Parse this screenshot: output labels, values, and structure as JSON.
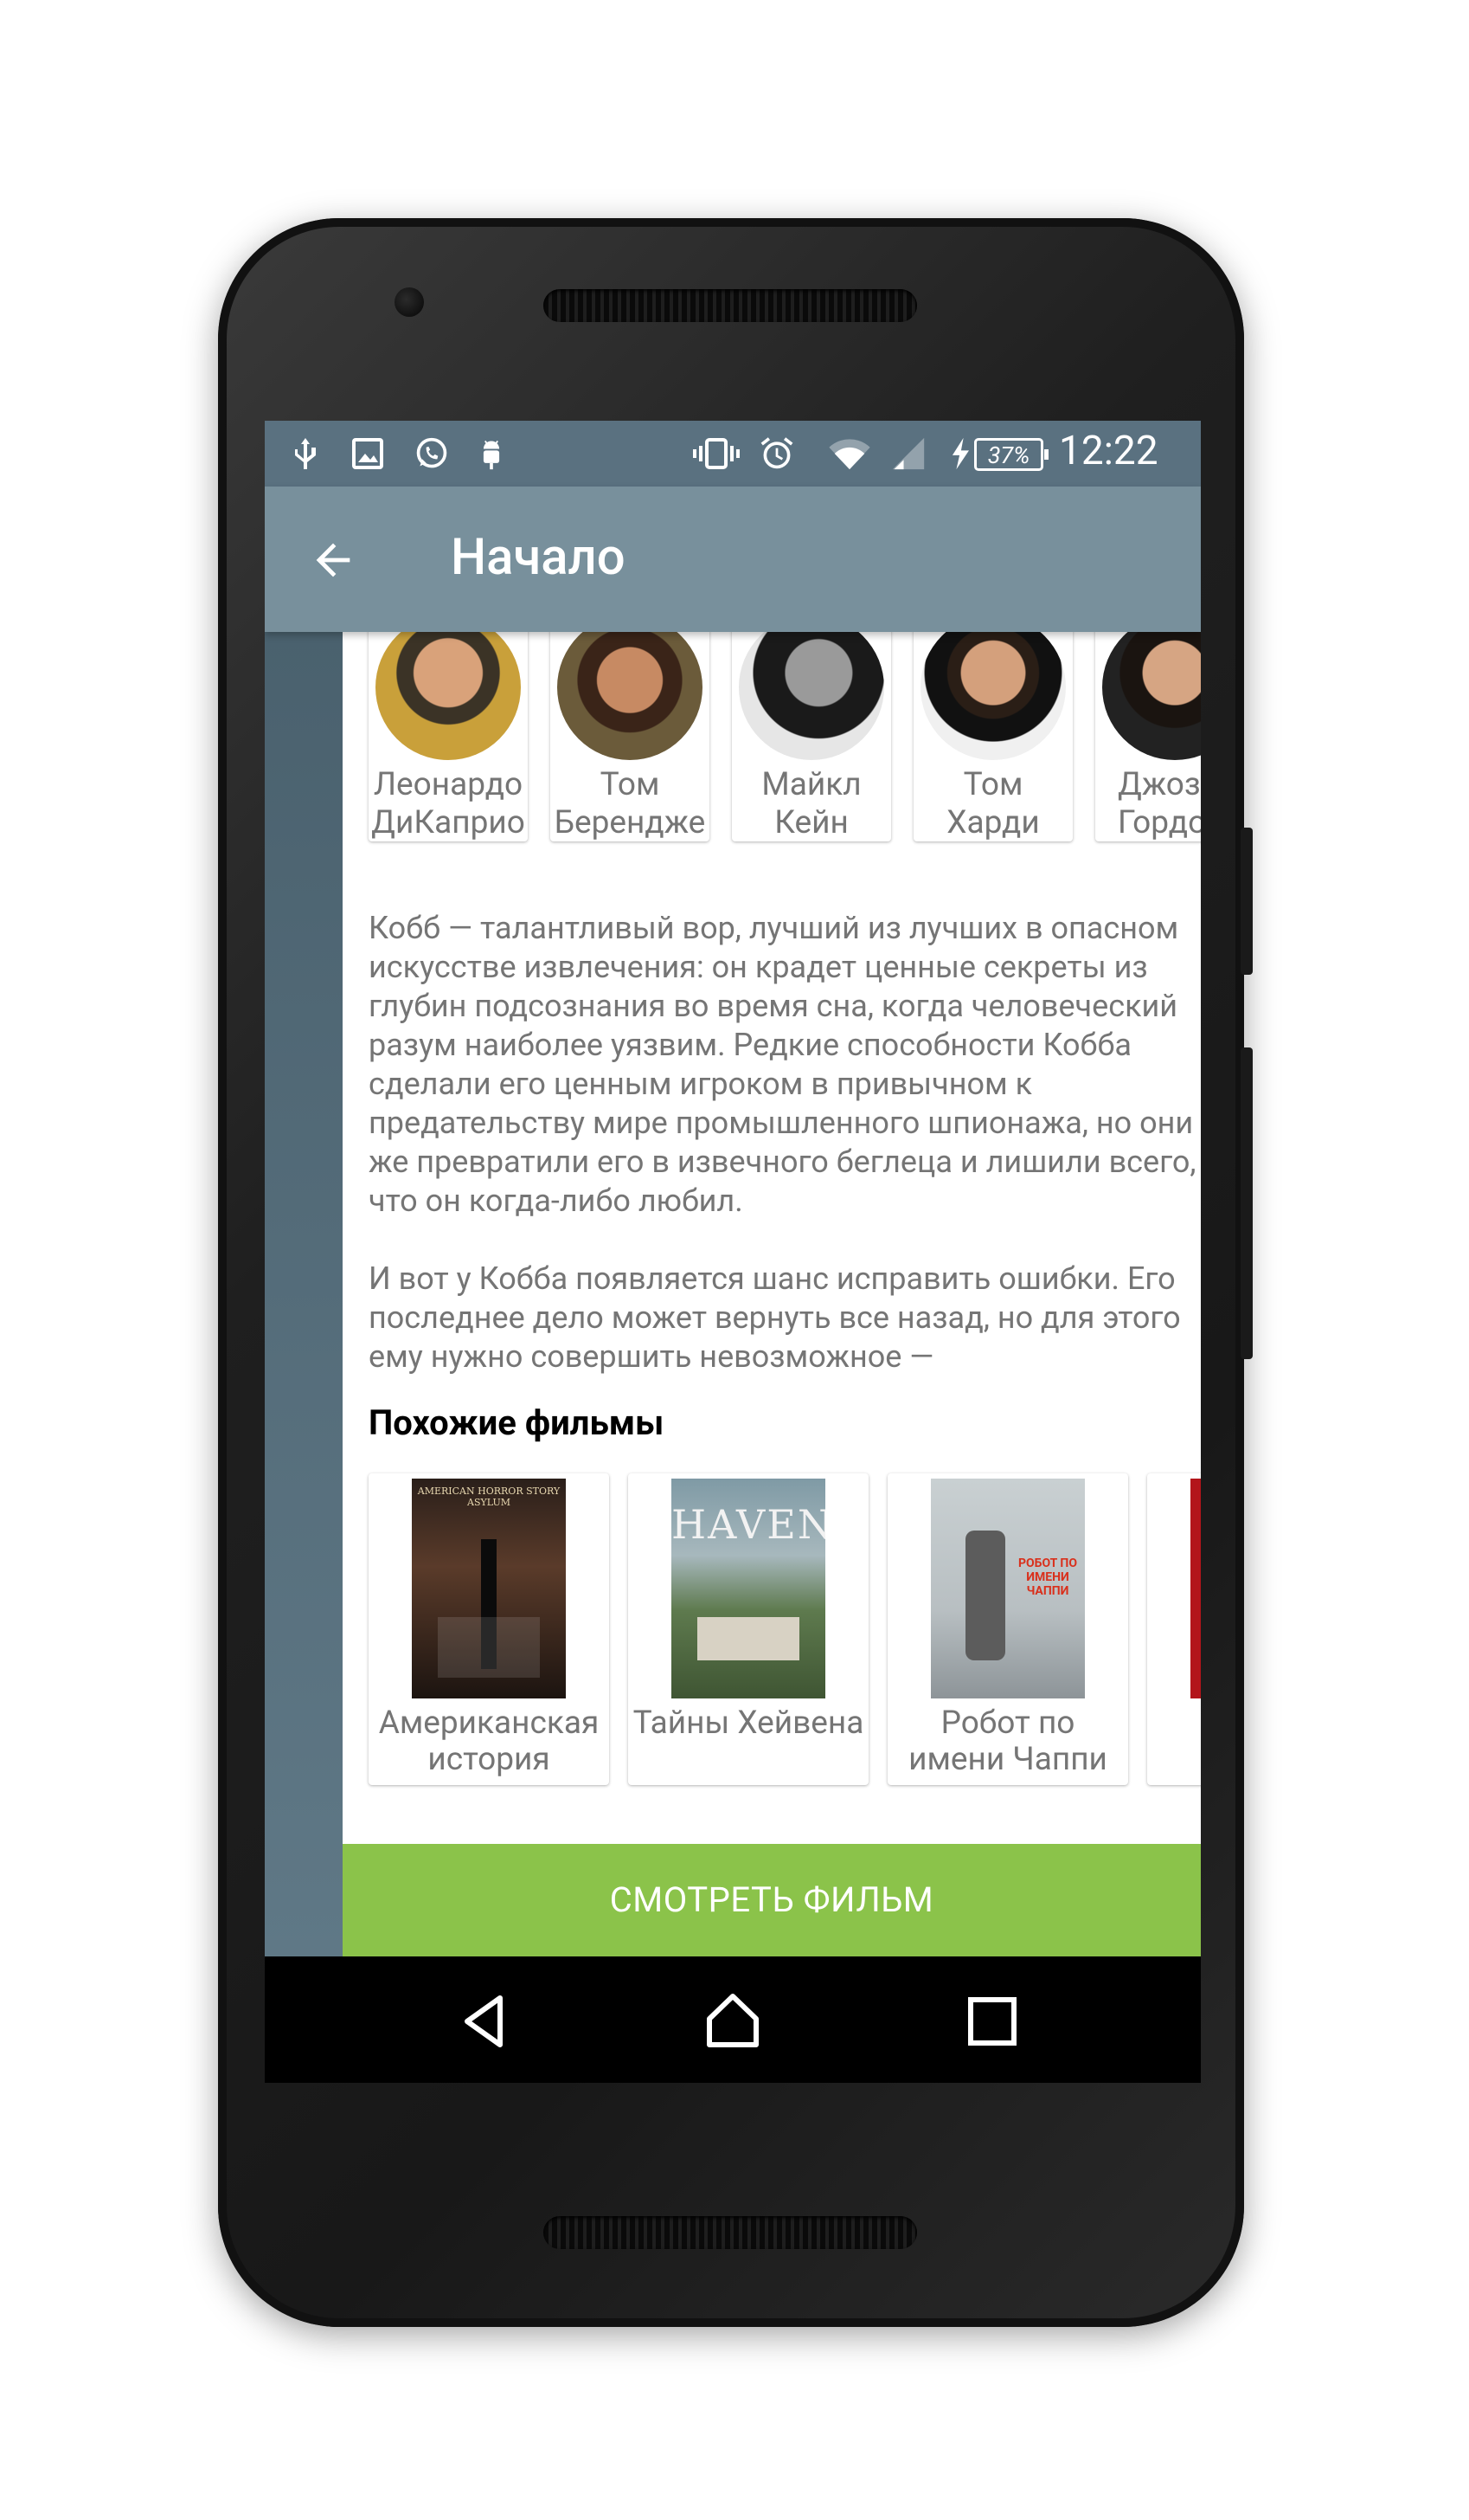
{
  "status_bar": {
    "battery": "37%",
    "time": "12:22",
    "left_icons": [
      "usb-icon",
      "image-icon",
      "whatsapp-icon",
      "android-debug-icon"
    ],
    "right_icons": [
      "vibrate-icon",
      "alarm-icon",
      "wifi-icon",
      "cell-signal-icon",
      "charging-icon",
      "battery-icon"
    ]
  },
  "toolbar": {
    "title": "Начало",
    "back_icon": "arrow-back-icon"
  },
  "cast": [
    {
      "line1": "Леонардо",
      "line2": "ДиКаприо"
    },
    {
      "line1": "Том",
      "line2": "Берендже"
    },
    {
      "line1": "Майкл",
      "line2": "Кейн"
    },
    {
      "line1": "Том Харди",
      "line2": ""
    },
    {
      "line1": "Джоз",
      "line2": "Гордо"
    }
  ],
  "description": {
    "p1": "Кобб — талантливый вор, лучший из лучших в опасном искусстве извлечения: он крадет ценные секреты из глубин подсознания во время сна, когда человеческий разум наиболее уязвим. Редкие способности Кобба сделали его ценным игроком в привычном к предательству мире промышленного шпионажа, но они же превратили его в извечного беглеца и лишили всего, что он когда-либо любил.",
    "p2": "И вот у Кобба появляется шанс исправить ошибки. Его последнее дело может вернуть все назад, но для этого ему нужно совершить невозможное —"
  },
  "similar": {
    "title": "Похожие фильмы",
    "movies": [
      {
        "line1": "Американская",
        "line2": "история",
        "poster_caption": "AMERICAN HORROR STORY ASYLUM"
      },
      {
        "line1": "Тайны Хейвена",
        "line2": "",
        "poster_caption": "HAVEN"
      },
      {
        "line1": "Робот по",
        "line2": "имени Чаппи",
        "poster_caption": "РОБОТ ПО ИМЕНИ ЧАППИ"
      }
    ]
  },
  "watch_button": "СМОТРЕТЬ ФИЛЬМ",
  "nav": {
    "back": "nav-back-icon",
    "home": "nav-home-icon",
    "recents": "nav-recents-icon"
  },
  "colors": {
    "status_bar": "#5a7180",
    "toolbar": "#78909c",
    "accent_button": "#8bc34a",
    "body_text": "#757575"
  }
}
